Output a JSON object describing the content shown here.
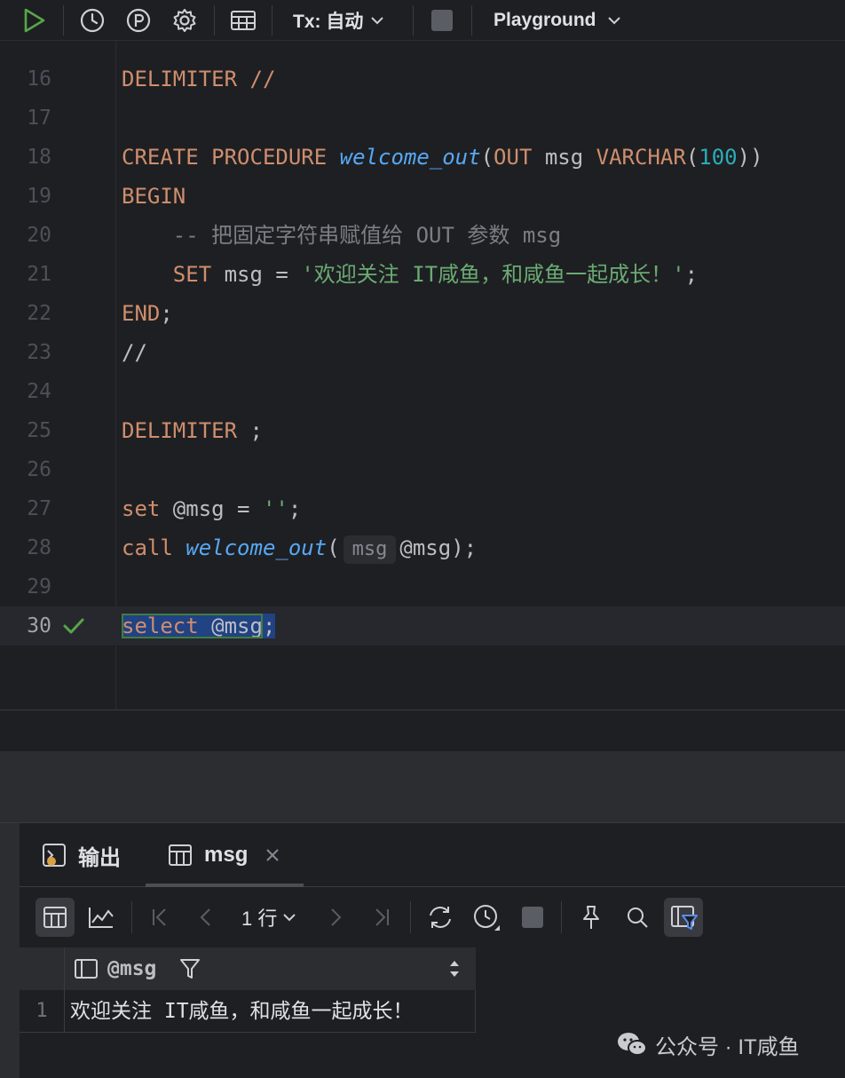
{
  "toolbar": {
    "tx_label": "Tx: 自动",
    "playground_label": "Playground"
  },
  "editor": {
    "lines": [
      {
        "num": "16"
      },
      {
        "num": "17"
      },
      {
        "num": "18"
      },
      {
        "num": "19"
      },
      {
        "num": "20"
      },
      {
        "num": "21"
      },
      {
        "num": "22"
      },
      {
        "num": "23"
      },
      {
        "num": "24"
      },
      {
        "num": "25"
      },
      {
        "num": "26"
      },
      {
        "num": "27"
      },
      {
        "num": "28"
      },
      {
        "num": "29"
      },
      {
        "num": "30"
      }
    ],
    "code": {
      "l16": "DELIMITER //",
      "l18_kw": "CREATE PROCEDURE ",
      "l18_fn": "welcome_out",
      "l18_p1": "(",
      "l18_out": "OUT",
      "l18_msg": " msg ",
      "l18_type": "VARCHAR",
      "l18_p2": "(",
      "l18_num": "100",
      "l18_p3": "))",
      "l19": "BEGIN",
      "l20": "    -- 把固定字符串赋值给 OUT 参数 msg",
      "l21_indent": "    ",
      "l21_kw": "SET",
      "l21_mid": " msg = ",
      "l21_str": "'欢迎关注 IT咸鱼，和咸鱼一起成长！'",
      "l21_end": ";",
      "l22_kw": "END",
      "l22_end": ";",
      "l23": "//",
      "l25_kw": "DELIMITER",
      "l25_end": " ;",
      "l27_kw": "set",
      "l27_mid": " @msg = ",
      "l27_str": "''",
      "l27_end": ";",
      "l28_kw": "call ",
      "l28_fn": "welcome_out",
      "l28_p1": "(",
      "l28_hint": "msg",
      "l28_rest": "@msg);",
      "l30_kw": "select",
      "l30_sp": " ",
      "l30_var": "@msg",
      "l30_end": ";"
    }
  },
  "panel": {
    "tabs": [
      {
        "label": "输出"
      },
      {
        "label": "msg"
      }
    ],
    "rows_label": "1 行",
    "column": "@msg",
    "rows": [
      {
        "num": "1",
        "value": "欢迎关注 IT咸鱼，和咸鱼一起成长！"
      }
    ]
  },
  "watermark": "公众号 · IT咸鱼",
  "colors": {
    "accent_green": "#57a64a",
    "keyword": "#cf8e6d",
    "function": "#56a8f5",
    "string": "#6aab73",
    "number": "#2aacb8",
    "selection": "#214283"
  }
}
